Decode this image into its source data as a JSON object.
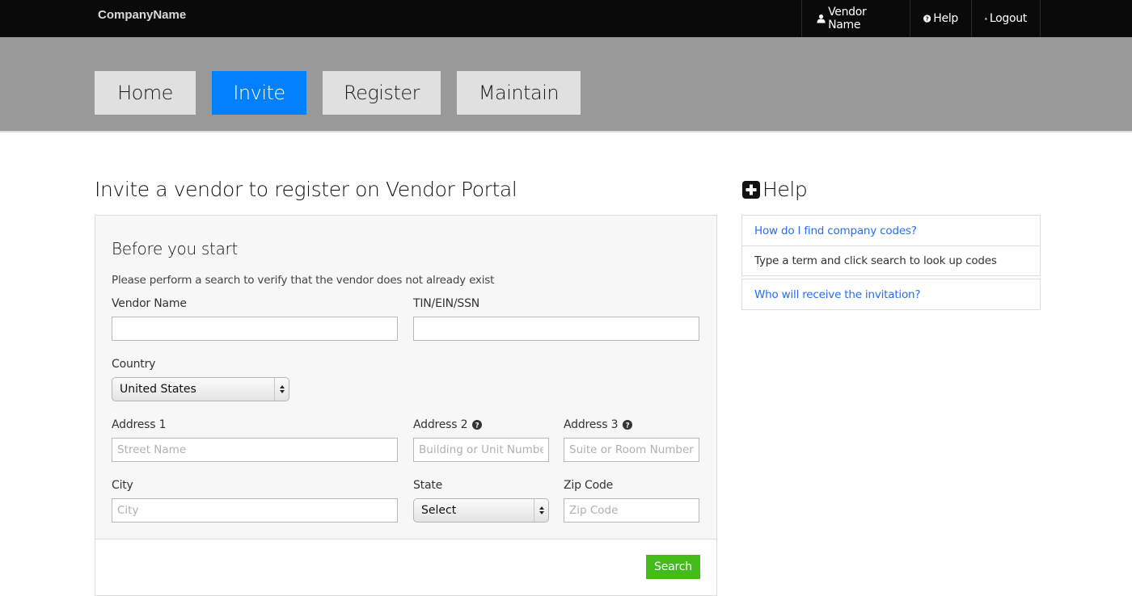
{
  "header": {
    "brand": "CompanyName",
    "nav": [
      {
        "label": "Vendor Name",
        "icon": "user-icon"
      },
      {
        "label": "Help",
        "icon": "question-circle-icon"
      },
      {
        "label": "Logout",
        "icon": "lock-icon"
      }
    ]
  },
  "tabs": [
    {
      "label": "Home",
      "active": false
    },
    {
      "label": "Invite",
      "active": true
    },
    {
      "label": "Register",
      "active": false
    },
    {
      "label": "Maintain",
      "active": false
    }
  ],
  "main": {
    "title": "Invite a vendor to register on Vendor Portal",
    "panel": {
      "heading": "Before you start",
      "intro": "Please perform a search to verify that the vendor does not already exist",
      "fields": {
        "vendor_name": {
          "label": "Vendor Name",
          "value": "",
          "placeholder": ""
        },
        "tin": {
          "label": "TIN/EIN/SSN",
          "value": "",
          "placeholder": ""
        },
        "country": {
          "label": "Country",
          "selected": "United States"
        },
        "address1": {
          "label": "Address 1",
          "value": "",
          "placeholder": "Street Name"
        },
        "address2": {
          "label": "Address 2",
          "value": "",
          "placeholder": "Building or Unit Number",
          "help_icon": "question-circle-icon"
        },
        "address3": {
          "label": "Address 3",
          "value": "",
          "placeholder": "Suite or Room Number",
          "help_icon": "question-circle-icon"
        },
        "city": {
          "label": "City",
          "value": "",
          "placeholder": "City"
        },
        "state": {
          "label": "State",
          "selected": "Select"
        },
        "zip": {
          "label": "Zip Code",
          "value": "",
          "placeholder": "Zip Code"
        }
      },
      "search_label": "Search"
    }
  },
  "help": {
    "title": "Help",
    "icon": "plus-square-icon",
    "items": [
      {
        "question": "How do I find company codes?",
        "answer": "Type a term and click search to look up codes",
        "expanded": true
      },
      {
        "question": "Who will receive the invitation?",
        "expanded": false
      }
    ]
  },
  "colors": {
    "topbar": "#0a0a0a",
    "band": "#999999",
    "tab_active": "#0180fe",
    "tab_inactive": "#e0e0e0",
    "search_button": "#43bc1a",
    "link": "#2a6cf0"
  }
}
